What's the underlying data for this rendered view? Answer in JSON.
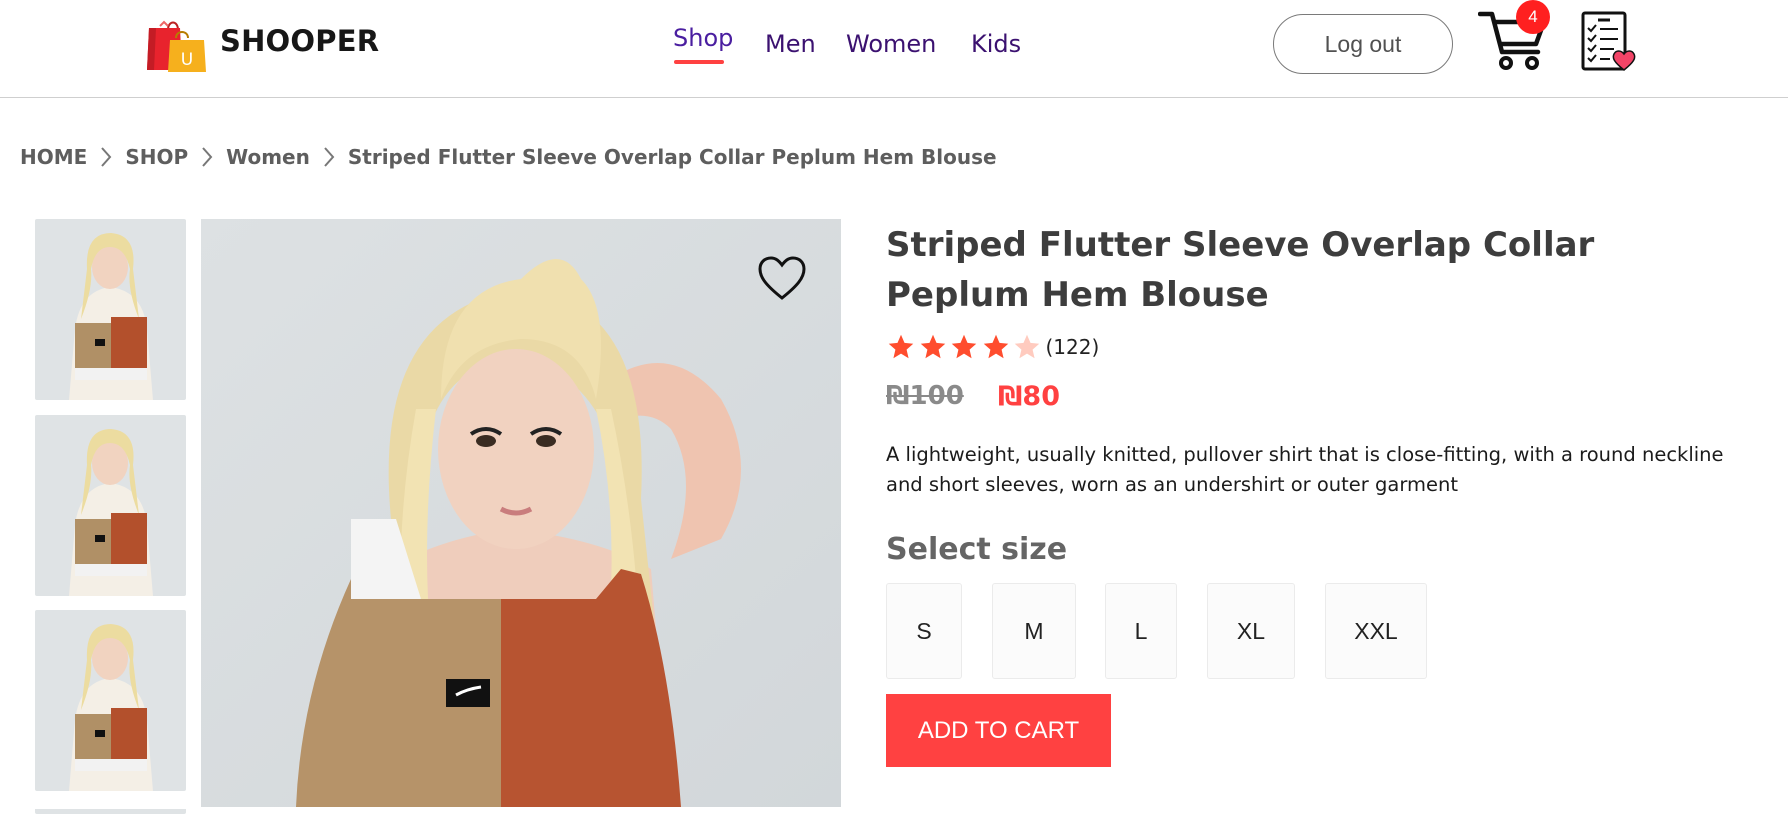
{
  "navbar": {
    "brand": "SHOOPER",
    "logo_icon": "shopping-bags-icon",
    "logo_letter": "U",
    "menu": [
      {
        "label": "Shop",
        "active": true
      },
      {
        "label": "Men",
        "active": false
      },
      {
        "label": "Women",
        "active": false
      },
      {
        "label": "Kids",
        "active": false
      }
    ],
    "logout_label": "Log out",
    "cart_count": "4",
    "cart_icon": "shopping-cart-icon",
    "wishlist_icon": "wishlist-checklist-heart-icon"
  },
  "breadcrumb": {
    "items": [
      "HOME",
      "SHOP",
      "Women",
      "Striped Flutter Sleeve Overlap Collar Peplum Hem Blouse"
    ],
    "separator_icon": "chevron-right-icon"
  },
  "gallery": {
    "thumbnails": [
      "product-thumbnail-1",
      "product-thumbnail-2",
      "product-thumbnail-3",
      "product-thumbnail-4"
    ],
    "main_image": "model-wearing-two-tone-crop-top",
    "favorite_icon": "heart-outline-icon"
  },
  "product": {
    "title": "Striped Flutter Sleeve Overlap Collar Peplum Hem Blouse",
    "rating": 4,
    "rating_max": 5,
    "review_count": "(122)",
    "old_price": "₪100",
    "new_price": "₪80",
    "description": "A lightweight, usually knitted, pullover shirt that is close-fitting, with a round neckline and short sleeves, worn as an undershirt or outer garment",
    "size_heading": "Select size",
    "sizes": [
      "S",
      "M",
      "L",
      "XL",
      "XXL"
    ],
    "add_to_cart_label": "ADD TO CART"
  },
  "colors": {
    "accent": "#ff4141",
    "nav_text": "#3b1170",
    "star_filled": "#ff4d2e",
    "star_empty": "#ffcbbf"
  }
}
